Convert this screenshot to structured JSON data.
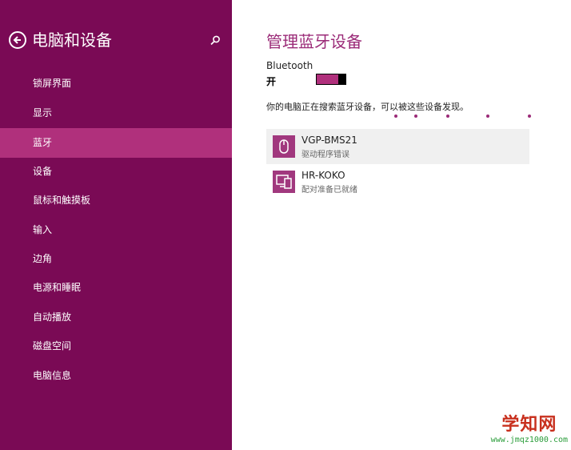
{
  "sidebar": {
    "title": "电脑和设备",
    "items": [
      {
        "label": "锁屏界面"
      },
      {
        "label": "显示"
      },
      {
        "label": "蓝牙"
      },
      {
        "label": "设备"
      },
      {
        "label": "鼠标和触摸板"
      },
      {
        "label": "输入"
      },
      {
        "label": "边角"
      },
      {
        "label": "电源和睡眠"
      },
      {
        "label": "自动播放"
      },
      {
        "label": "磁盘空间"
      },
      {
        "label": "电脑信息"
      }
    ],
    "selected_item": "蓝牙",
    "icons": {
      "back": "back-arrow-icon",
      "search": "search-icon"
    }
  },
  "main": {
    "title": "管理蓝牙设备",
    "bluetooth_label": "Bluetooth",
    "bluetooth_state": "开",
    "bluetooth_on": true,
    "search_status": "你的电脑正在搜索蓝牙设备，可以被这些设备发现。",
    "devices": [
      {
        "name": "VGP-BMS21",
        "status": "驱动程序错误",
        "icon": "mouse-icon"
      },
      {
        "name": "HR-KOKO",
        "status": "配对准备已就绪",
        "icon": "phone-icon"
      }
    ]
  },
  "watermark": {
    "text": "学知网",
    "url": "www.jmqz1000.com"
  },
  "colors": {
    "sidebar_bg": "#7a0a55",
    "accent": "#b0307c",
    "title": "#9b2b78",
    "device_icon_bg": "#a1387e"
  }
}
